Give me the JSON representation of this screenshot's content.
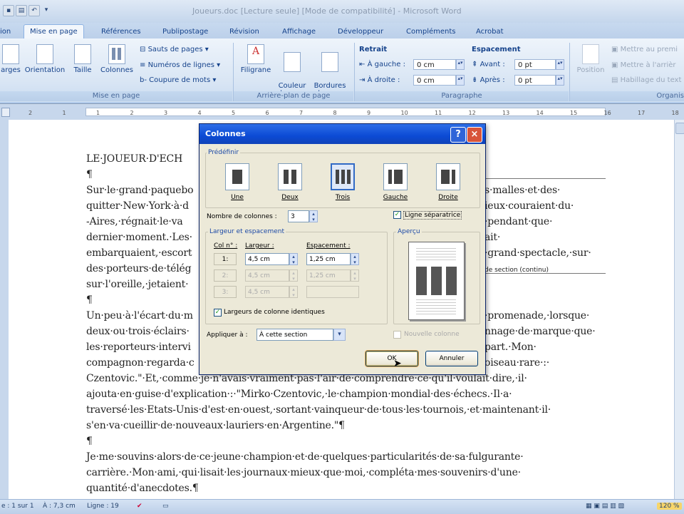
{
  "window": {
    "title": "Joueurs.doc [Lecture seule] [Mode de compatibilité] - Microsoft Word"
  },
  "tabs": [
    "ion",
    "Mise en page",
    "Références",
    "Publipostage",
    "Révision",
    "Affichage",
    "Développeur",
    "Compléments",
    "Acrobat"
  ],
  "ribbon": {
    "mise_en_page": {
      "label": "Mise en page",
      "buttons": [
        "arges",
        "Orientation",
        "Taille",
        "Colonnes"
      ],
      "small": [
        "Sauts de pages",
        "Numéros de lignes",
        "Coupure de mots"
      ]
    },
    "arriere_plan": {
      "label": "Arrière-plan de page",
      "buttons": [
        "Filigrane",
        "Couleur\nde page",
        "Bordures\nde page"
      ]
    },
    "paragraphe": {
      "label": "Paragraphe",
      "retrait_label": "Retrait",
      "gauche_label": "À gauche :",
      "gauche_value": "0 cm",
      "droite_label": "À droite :",
      "droite_value": "0 cm",
      "espacement_label": "Espacement",
      "avant_label": "Avant :",
      "avant_value": "0 pt",
      "apres_label": "Après :",
      "apres_value": "0 pt"
    },
    "organiser": {
      "label": "Organis",
      "position": "Position",
      "items": [
        "Mettre au premi",
        "Mettre à l'arrièr",
        "Habillage du text"
      ]
    }
  },
  "ruler": {
    "ticks": [
      "2",
      "1",
      "1",
      "2",
      "3",
      "4",
      "5",
      "6",
      "7",
      "8",
      "9",
      "10",
      "11",
      "12",
      "13",
      "14",
      "15",
      "16",
      "17",
      "18"
    ]
  },
  "document": {
    "lines": [
      "LE·JOUEUR·D'ECH",
      "¶",
      "Sur·le·grand·paquebo",
      "quitter·New·York·à·d",
      "-Aires,·régnait·le·va",
      "dernier·moment.·Les·",
      "embarquaient,·escort",
      "des·porteurs·de·télég",
      "sur·l'oreille,·jetaient·",
      "¶",
      "Un·peu·à·l'écart·du·m",
      "deux·ou·trois·éclairs·",
      "les·reporteurs·intervi",
      "compagnon·regarda·c",
      "Czentovic.\"·Et,·comme·je·n'avais·vraiment·pas·l'air·de·comprendre·ce·qu'il·voulait·dire,·il·",
      "ajouta·en·guise·d'explication·:·\"Mirko·Czentovic,·le·champion·mondial·des·échecs.·Il·a·",
      "traversé·les·Etats-Unis·d'est·en·ouest,·sortant·vainqueur·de·tous·les·tournois,·et·maintenant·il·",
      "s'en·va·cueillir·de·nouveaux·lauriers·en·Argentine.\"¶",
      "¶",
      "Je·me·souvins·alors·de·ce·jeune·champion·et·de·quelques·particularités·de·sa·fulgurante·",
      "carrière.·Mon·ami,·qui·lisait·les·journaux·mieux·que·moi,·compléta·mes·souvenirs·d'une·",
      "quantité·d'anecdotes.¶"
    ],
    "right_fragments": [
      "s·malles·et·des·",
      "ieux·couraient·du·",
      "·pendant·que·",
      "ait·",
      "·grand·spectacle,·sur·",
      "de section (continu)",
      "·promenade,·lorsque·",
      "nnage·de·marque·que·",
      "part.·Mon·",
      "oiseau·rare·:·"
    ]
  },
  "dialog": {
    "title": "Colonnes",
    "predefini_label": "Prédéfinir",
    "presets": [
      "Une",
      "Deux",
      "Trois",
      "Gauche",
      "Droite"
    ],
    "nombre_label": "Nombre de colonnes :",
    "nombre_value": "3",
    "ligne_sep_label": "Ligne séparatrice",
    "largeur_label": "Largeur et espacement",
    "apercu_label": "Aperçu",
    "col_header": "Col n° :",
    "largeur_header": "Largeur :",
    "espacement_header": "Espacement :",
    "rows": [
      {
        "num": "1:",
        "largeur": "4,5 cm",
        "espacement": "1,25 cm"
      },
      {
        "num": "2:",
        "largeur": "4,5 cm",
        "espacement": "1,25 cm"
      },
      {
        "num": "3:",
        "largeur": "4,5 cm",
        "espacement": ""
      }
    ],
    "identiques_label": "Largeurs de colonne identiques",
    "appliquer_label": "Appliquer à :",
    "appliquer_value": "À cette section",
    "nouvelle_colonne_label": "Nouvelle colonne",
    "ok_label": "OK",
    "cancel_label": "Annuler"
  },
  "status": {
    "page": "e : 1 sur 1",
    "position": "À : 7,3 cm",
    "ligne": "Ligne : 19",
    "zoom": "120 %"
  }
}
